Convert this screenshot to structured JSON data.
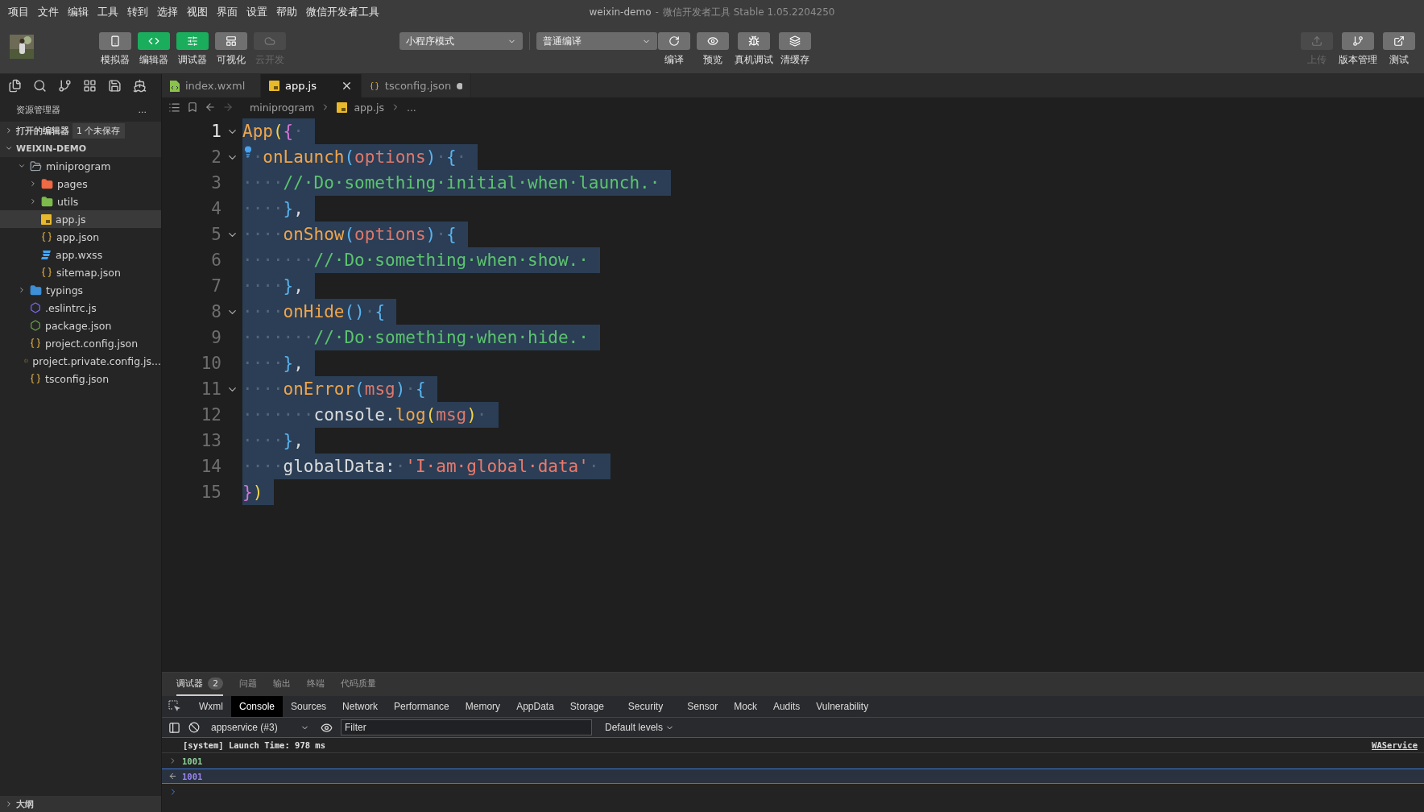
{
  "menu": [
    "项目",
    "文件",
    "编辑",
    "工具",
    "转到",
    "选择",
    "视图",
    "界面",
    "设置",
    "帮助",
    "微信开发者工具"
  ],
  "window": {
    "project": "weixin-demo",
    "separator": "-",
    "app": "微信开发者工具 Stable 1.05.2204250"
  },
  "toolbar": {
    "views": [
      {
        "label": "模拟器",
        "on": false,
        "disabled": false
      },
      {
        "label": "编辑器",
        "on": true,
        "disabled": false
      },
      {
        "label": "调试器",
        "on": true,
        "disabled": false
      },
      {
        "label": "可视化",
        "on": false,
        "disabled": false
      },
      {
        "label": "云开发",
        "on": false,
        "disabled": true
      }
    ],
    "mode": "小程序模式",
    "compile_mode": "普通编译",
    "actions": [
      {
        "label": "编译"
      },
      {
        "label": "预览"
      },
      {
        "label": "真机调试"
      },
      {
        "label": "清缓存"
      }
    ],
    "right": [
      {
        "label": "上传",
        "disabled": true
      },
      {
        "label": "版本管理",
        "disabled": false
      },
      {
        "label": "测试",
        "disabled": false
      }
    ]
  },
  "explorer": {
    "title": "资源管理器",
    "more": "...",
    "open_editors": {
      "label": "打开的编辑器",
      "badge": "1 个未保存",
      "expanded": false
    },
    "project": {
      "label": "WEIXIN-DEMO",
      "expanded": true
    },
    "tree": [
      {
        "name": "miniprogram",
        "kind": "folder",
        "color": "#9aa4ad",
        "expanded": true,
        "selected": false,
        "children": [
          {
            "name": "pages",
            "kind": "folder",
            "color": "#ef6a45",
            "expanded": false,
            "selected": false
          },
          {
            "name": "utils",
            "kind": "folder",
            "color": "#7cbb4c",
            "expanded": false,
            "selected": false
          },
          {
            "name": "app.js",
            "kind": "js",
            "selected": true
          },
          {
            "name": "app.json",
            "kind": "json",
            "selected": false
          },
          {
            "name": "app.wxss",
            "kind": "wxss",
            "selected": false
          },
          {
            "name": "sitemap.json",
            "kind": "json",
            "selected": false
          }
        ]
      },
      {
        "name": "typings",
        "kind": "folder",
        "color": "#3d8fd6",
        "expanded": false,
        "selected": false
      },
      {
        "name": ".eslintrc.js",
        "kind": "eslint",
        "selected": false
      },
      {
        "name": "package.json",
        "kind": "node",
        "selected": false
      },
      {
        "name": "project.config.json",
        "kind": "json",
        "selected": false
      },
      {
        "name": "project.private.config.js...",
        "kind": "json",
        "selected": false
      },
      {
        "name": "tsconfig.json",
        "kind": "json",
        "selected": false
      }
    ],
    "outline": "大纲"
  },
  "tabs": [
    {
      "label": "index.wxml",
      "kind": "wxml",
      "selected": false,
      "modified": false
    },
    {
      "label": "app.js",
      "kind": "js",
      "selected": true,
      "modified": false
    },
    {
      "label": "tsconfig.json",
      "kind": "json",
      "selected": false,
      "modified": true
    }
  ],
  "breadcrumb": [
    {
      "label": "miniprogram",
      "kind": "folder"
    },
    {
      "label": "app.js",
      "kind": "js"
    },
    {
      "label": "...",
      "kind": "more"
    }
  ],
  "code": [
    {
      "n": "1",
      "current": true,
      "fold": true,
      "bulb": false,
      "selected": true,
      "tokens": [
        {
          "text": "App",
          "kind": "fn"
        },
        {
          "text": "(",
          "kind": "p1"
        },
        {
          "text": "{",
          "kind": "p2"
        },
        {
          "text": "·",
          "kind": "ws"
        }
      ]
    },
    {
      "n": "2",
      "current": false,
      "fold": true,
      "bulb": true,
      "selected": true,
      "tokens": [
        {
          "text": "··",
          "kind": "ws"
        },
        {
          "text": "onLaunch",
          "kind": "fn"
        },
        {
          "text": "(",
          "kind": "p3"
        },
        {
          "text": "options",
          "kind": "param"
        },
        {
          "text": ")",
          "kind": "p3"
        },
        {
          "text": "·",
          "kind": "ws"
        },
        {
          "text": "{",
          "kind": "p3"
        },
        {
          "text": "·",
          "kind": "ws"
        }
      ]
    },
    {
      "n": "3",
      "current": false,
      "fold": false,
      "bulb": false,
      "selected": true,
      "tokens": [
        {
          "text": "····",
          "kind": "ws"
        },
        {
          "text": "//·Do·something·initial·when·launch.·",
          "kind": "comment"
        }
      ]
    },
    {
      "n": "4",
      "current": false,
      "fold": false,
      "bulb": false,
      "selected": true,
      "tokens": [
        {
          "text": "····",
          "kind": "ws"
        },
        {
          "text": "}",
          "kind": "p3"
        },
        {
          "text": ",",
          "kind": "plain"
        }
      ]
    },
    {
      "n": "5",
      "current": false,
      "fold": true,
      "bulb": false,
      "selected": true,
      "tokens": [
        {
          "text": "····",
          "kind": "ws"
        },
        {
          "text": "onShow",
          "kind": "fn"
        },
        {
          "text": "(",
          "kind": "p3"
        },
        {
          "text": "options",
          "kind": "param"
        },
        {
          "text": ")",
          "kind": "p3"
        },
        {
          "text": "·",
          "kind": "ws"
        },
        {
          "text": "{",
          "kind": "p3"
        }
      ]
    },
    {
      "n": "6",
      "current": false,
      "fold": false,
      "bulb": false,
      "selected": true,
      "tokens": [
        {
          "text": "·······",
          "kind": "ws"
        },
        {
          "text": "//·Do·something·when·show.·",
          "kind": "comment"
        }
      ]
    },
    {
      "n": "7",
      "current": false,
      "fold": false,
      "bulb": false,
      "selected": true,
      "tokens": [
        {
          "text": "····",
          "kind": "ws"
        },
        {
          "text": "}",
          "kind": "p3"
        },
        {
          "text": ",",
          "kind": "plain"
        }
      ]
    },
    {
      "n": "8",
      "current": false,
      "fold": true,
      "bulb": false,
      "selected": true,
      "tokens": [
        {
          "text": "····",
          "kind": "ws"
        },
        {
          "text": "onHide",
          "kind": "fn"
        },
        {
          "text": "()",
          "kind": "p3"
        },
        {
          "text": "·",
          "kind": "ws"
        },
        {
          "text": "{",
          "kind": "p3"
        }
      ]
    },
    {
      "n": "9",
      "current": false,
      "fold": false,
      "bulb": false,
      "selected": true,
      "tokens": [
        {
          "text": "·······",
          "kind": "ws"
        },
        {
          "text": "//·Do·something·when·hide.·",
          "kind": "comment"
        }
      ]
    },
    {
      "n": "10",
      "current": false,
      "fold": false,
      "bulb": false,
      "selected": true,
      "tokens": [
        {
          "text": "····",
          "kind": "ws"
        },
        {
          "text": "}",
          "kind": "p3"
        },
        {
          "text": ",",
          "kind": "plain"
        }
      ]
    },
    {
      "n": "11",
      "current": false,
      "fold": true,
      "bulb": false,
      "selected": true,
      "tokens": [
        {
          "text": "····",
          "kind": "ws"
        },
        {
          "text": "onError",
          "kind": "fn"
        },
        {
          "text": "(",
          "kind": "p3"
        },
        {
          "text": "msg",
          "kind": "param"
        },
        {
          "text": ")",
          "kind": "p3"
        },
        {
          "text": "·",
          "kind": "ws"
        },
        {
          "text": "{",
          "kind": "p3"
        }
      ]
    },
    {
      "n": "12",
      "current": false,
      "fold": false,
      "bulb": false,
      "selected": true,
      "tokens": [
        {
          "text": "·······",
          "kind": "ws"
        },
        {
          "text": "console.",
          "kind": "plain"
        },
        {
          "text": "log",
          "kind": "fn"
        },
        {
          "text": "(",
          "kind": "p1"
        },
        {
          "text": "msg",
          "kind": "param"
        },
        {
          "text": ")",
          "kind": "p1"
        },
        {
          "text": "·",
          "kind": "ws"
        }
      ]
    },
    {
      "n": "13",
      "current": false,
      "fold": false,
      "bulb": false,
      "selected": true,
      "tokens": [
        {
          "text": "····",
          "kind": "ws"
        },
        {
          "text": "}",
          "kind": "p3"
        },
        {
          "text": ",",
          "kind": "plain"
        }
      ]
    },
    {
      "n": "14",
      "current": false,
      "fold": false,
      "bulb": false,
      "selected": true,
      "tokens": [
        {
          "text": "····",
          "kind": "ws"
        },
        {
          "text": "globalData:",
          "kind": "plain"
        },
        {
          "text": "·",
          "kind": "ws"
        },
        {
          "text": "'I·am·global·data'",
          "kind": "string"
        },
        {
          "text": "·",
          "kind": "ws"
        }
      ]
    },
    {
      "n": "15",
      "current": false,
      "fold": false,
      "bulb": false,
      "selected": true,
      "tokens": [
        {
          "text": "}",
          "kind": "p2"
        },
        {
          "text": ")",
          "kind": "p1"
        }
      ]
    }
  ],
  "panel": {
    "tabs": [
      {
        "label": "调试器",
        "badge": "2",
        "selected": true
      },
      {
        "label": "问题",
        "selected": false
      },
      {
        "label": "输出",
        "selected": false
      },
      {
        "label": "终端",
        "selected": false
      },
      {
        "label": "代码质量",
        "selected": false
      }
    ],
    "devtools_tabs": [
      {
        "label": "Wxml",
        "selected": false
      },
      {
        "label": "Console",
        "selected": true
      },
      {
        "label": "Sources",
        "selected": false
      },
      {
        "label": "Network",
        "selected": false
      },
      {
        "label": "Performance",
        "selected": false
      },
      {
        "label": "Memory",
        "selected": false
      },
      {
        "label": "AppData",
        "selected": false
      },
      {
        "label": "Storage",
        "selected": false
      },
      {
        "label": "Security",
        "selected": false
      },
      {
        "label": "Sensor",
        "selected": false
      },
      {
        "label": "Mock",
        "selected": false
      },
      {
        "label": "Audits",
        "selected": false
      },
      {
        "label": "Vulnerability",
        "selected": false
      }
    ],
    "context": "appservice (#3)",
    "filter": {
      "placeholder": "Filter"
    },
    "levels": "Default levels",
    "console": [
      {
        "kind": "system",
        "text": "[system] Launch Time: 978 ms",
        "source": "WAService"
      },
      {
        "kind": "input",
        "text": "1001"
      },
      {
        "kind": "result",
        "text": "1001"
      },
      {
        "kind": "prompt"
      }
    ]
  }
}
